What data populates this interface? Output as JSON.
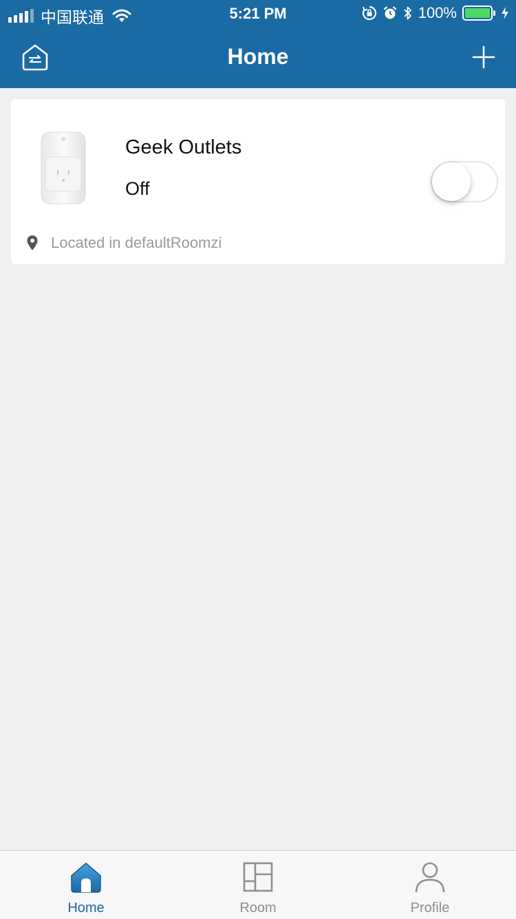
{
  "status_bar": {
    "carrier": "中国联通",
    "time": "5:21 PM",
    "battery": "100%"
  },
  "nav": {
    "title": "Home",
    "left_icon": "switch-home-icon",
    "right_icon": "plus-icon"
  },
  "device": {
    "name": "Geek  Outlets",
    "state": "Off",
    "switch_on": false,
    "location": "Located in defaultRoomzi",
    "image": "smart-plug-image"
  },
  "tabs": [
    {
      "label": "Home",
      "icon": "home-icon",
      "active": true
    },
    {
      "label": "Room",
      "icon": "room-layout-icon",
      "active": false
    },
    {
      "label": "Profile",
      "icon": "person-icon",
      "active": false
    }
  ],
  "colors": {
    "header": "#1a6aa4",
    "background": "#efefef",
    "active_tab": "#1a6aa4",
    "inactive_tab": "#8e8e8e",
    "battery": "#4cd964"
  }
}
